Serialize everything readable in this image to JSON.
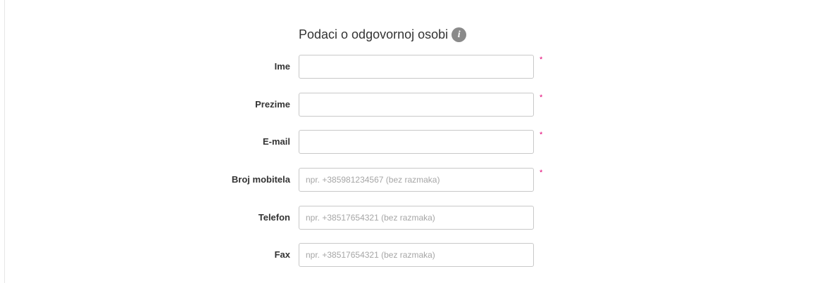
{
  "form": {
    "title": "Podaci o odgovornoj osobi",
    "info_icon": "info-icon",
    "required_marker": "*",
    "accent_color": "#e20074",
    "fields": [
      {
        "label": "Ime",
        "value": "",
        "placeholder": "",
        "required": true
      },
      {
        "label": "Prezime",
        "value": "",
        "placeholder": "",
        "required": true
      },
      {
        "label": "E-mail",
        "value": "",
        "placeholder": "",
        "required": true
      },
      {
        "label": "Broj mobitela",
        "value": "",
        "placeholder": "npr. +385981234567 (bez razmaka)",
        "required": true
      },
      {
        "label": "Telefon",
        "value": "",
        "placeholder": "npr. +38517654321 (bez razmaka)",
        "required": false
      },
      {
        "label": "Fax",
        "value": "",
        "placeholder": "npr. +38517654321 (bez razmaka)",
        "required": false
      }
    ]
  }
}
